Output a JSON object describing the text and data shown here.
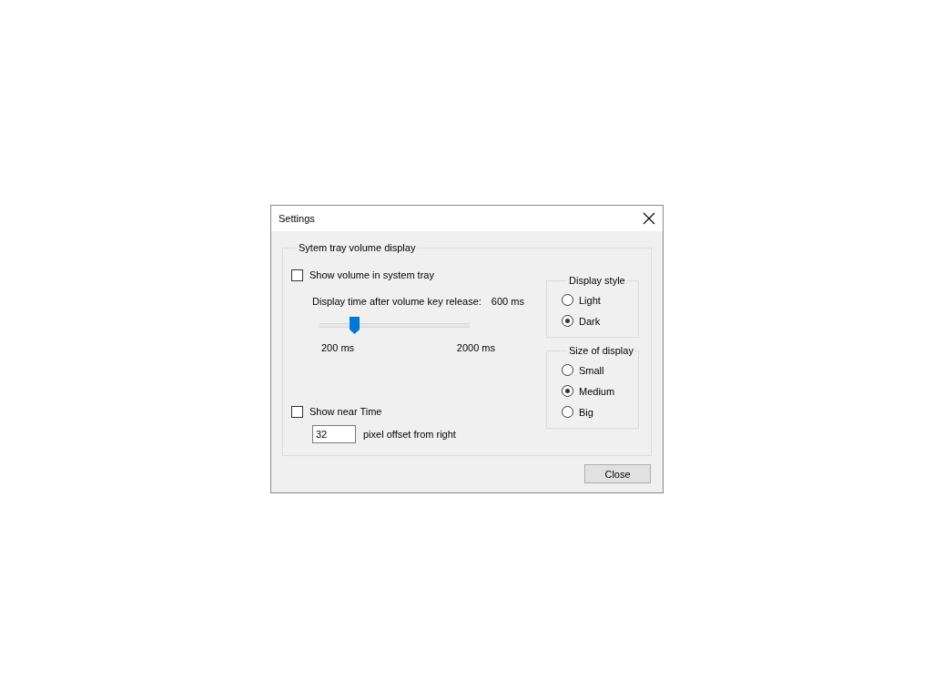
{
  "window": {
    "title": "Settings"
  },
  "group": {
    "title": "Sytem tray volume display",
    "show_in_tray": {
      "label": "Show volume in system tray",
      "checked": false
    },
    "display_time": {
      "label": "Display time after volume key release:",
      "reading": "600 ms",
      "level": 0.23,
      "min_label": "200 ms",
      "max_label": "2000 ms"
    },
    "show_near_time": {
      "label": "Show near Time",
      "checked": false
    },
    "offset": {
      "value": "32",
      "label": "pixel offset from right"
    },
    "display_style": {
      "title": "Display style",
      "options": [
        {
          "label": "Light",
          "selected": false
        },
        {
          "label": "Dark",
          "selected": true
        }
      ]
    },
    "size": {
      "title": "Size of display",
      "options": [
        {
          "label": "Small",
          "selected": false
        },
        {
          "label": "Medium",
          "selected": true
        },
        {
          "label": "Big",
          "selected": false
        }
      ]
    }
  },
  "buttons": [
    "Close"
  ]
}
